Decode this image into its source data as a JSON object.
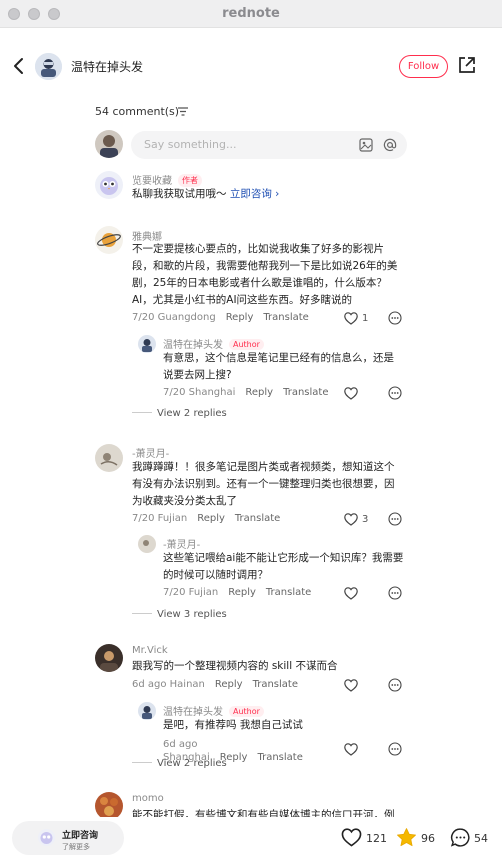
{
  "window": {
    "title": "rednote"
  },
  "header": {
    "author_name": "温特在掉头发",
    "follow_label": "Follow"
  },
  "comments_header": {
    "count_label": "54 comment(s)"
  },
  "input": {
    "placeholder": "Say something..."
  },
  "pinned": {
    "user": "览要收藏",
    "badge": "作者",
    "text": "私聊我获取试用哦～",
    "link": "立即咨询 ›"
  },
  "comments": [
    {
      "user": "雅典娜",
      "text": "不一定要提核心要点的，比如说我收集了好多的影视片段，和歌的片段，我需要他帮我列一下是比如说26年的美剧，25年的日本电影或者什么歌是谁唱的，什么版本？ AI，尤其是小红书的AI问这些东西。好多瞎说的",
      "date": "7/20 Guangdong",
      "reply": "Reply",
      "translate": "Translate",
      "likes": "1",
      "sub": {
        "user": "温特在掉头发",
        "badge": "Author",
        "text": "有意思，这个信息是笔记里已经有的信息么，还是说要去网上搜?",
        "date": "7/20 Shanghai",
        "reply": "Reply",
        "translate": "Translate"
      },
      "view_replies": "View 2 replies"
    },
    {
      "user": "-萧灵月-",
      "text": "我蹲蹲蹲！！很多笔记是图片类或者视频类，想知道这个有没有办法识别到。还有一个一键整理归类也很想要，因为收藏夹没分类太乱了",
      "date": "7/20 Fujian",
      "reply": "Reply",
      "translate": "Translate",
      "likes": "3",
      "sub": {
        "user": "-萧灵月-",
        "text": "这些笔记喂给ai能不能让它形成一个知识库？我需要的时候可以随时调用？",
        "date": "7/20 Fujian",
        "reply": "Reply",
        "translate": "Translate"
      },
      "view_replies": "View 3 replies"
    },
    {
      "user": "Mr.Vick",
      "text": "跟我写的一个整理视频内容的 skill 不谋而合",
      "date": "6d ago Hainan",
      "reply": "Reply",
      "translate": "Translate",
      "sub": {
        "user": "温特在掉头发",
        "badge": "Author",
        "text": "是吧，有推荐吗 我想自己试试",
        "date": "6d ago Shanghai",
        "reply": "Reply",
        "translate": "Translate"
      },
      "view_replies": "View 2 replies"
    },
    {
      "user": "momo",
      "text": "能不能打假，有些博文和有些自媒体博主的信口开河，例"
    }
  ],
  "bottom": {
    "consult_title": "立即咨询",
    "consult_sub": "了解更多",
    "likes": "121",
    "favorites": "96",
    "comments": "54"
  },
  "colors": {
    "accent": "#ff2e4d",
    "star": "#f5b800"
  }
}
